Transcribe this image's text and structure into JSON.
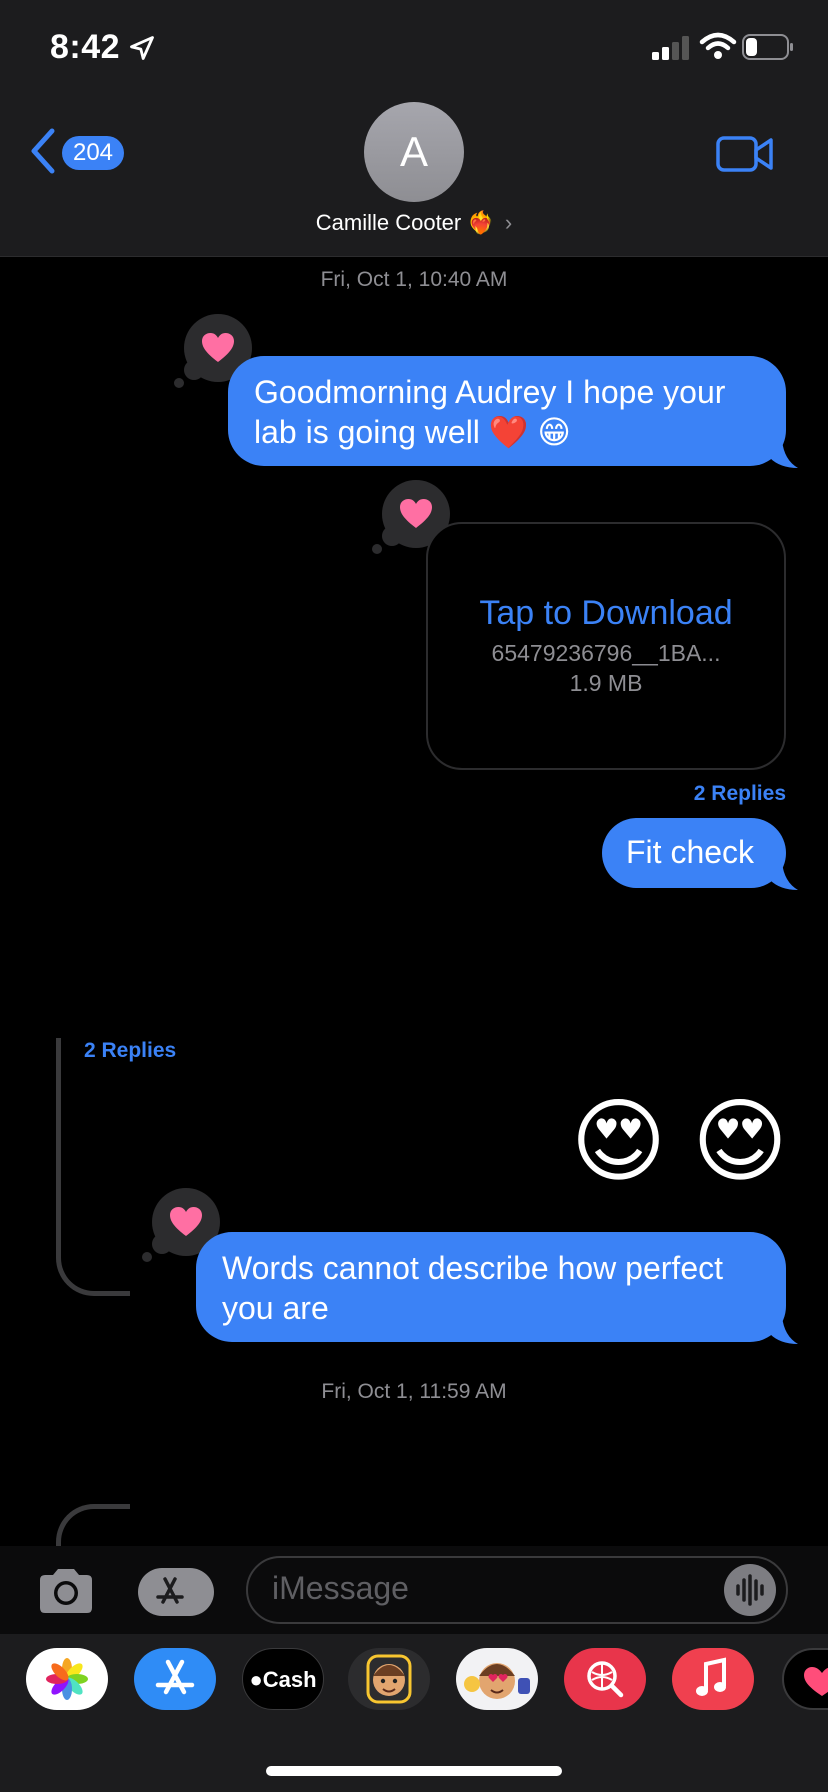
{
  "status_bar": {
    "time": "8:42"
  },
  "header": {
    "back_count": "204",
    "avatar_initial": "A",
    "contact_name": "Camille Cooter",
    "contact_emoji": "❤️‍🔥"
  },
  "messages": {
    "timestamp1_day": "Fri, Oct 1,",
    "timestamp1_time": "10:40 AM",
    "msg1": "Goodmorning Audrey I hope your lab is going well ❤️ 😁",
    "attachment": {
      "title": "Tap to Download",
      "filename": "65479236796__1BA...",
      "size": "1.9 MB"
    },
    "replies1": "2 Replies",
    "msg2": "Fit check",
    "replies2": "2 Replies",
    "emoji_message": "😍 😍",
    "msg3": "Words cannot describe how perfect you are",
    "timestamp2_day": "Fri, Oct 1,",
    "timestamp2_time": "11:59 AM"
  },
  "input": {
    "placeholder": "iMessage"
  },
  "drawer": {
    "apps": [
      "photos-icon",
      "app-store-icon",
      "apple-cash-icon",
      "memoji-icon",
      "memoji-stickers-icon",
      "search-images-icon",
      "music-icon",
      "digital-touch-icon"
    ],
    "cash_label": "Cash"
  },
  "colors": {
    "accent": "#3b82f6",
    "header_bg": "#1c1c1e",
    "background": "#000000",
    "tapback_heart": "#ff6fa3"
  }
}
